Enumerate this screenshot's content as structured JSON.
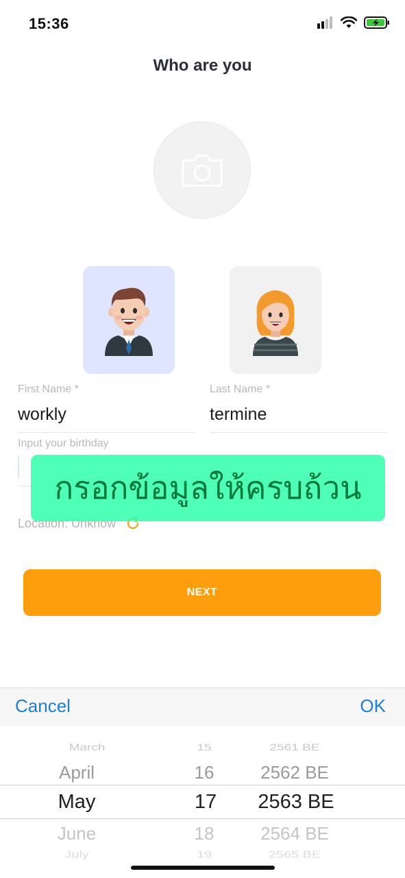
{
  "status": {
    "time": "15:36"
  },
  "header": {
    "title": "Who are you"
  },
  "form": {
    "first_name_label": "First Name *",
    "first_name_value": "workly",
    "last_name_label": "Last Name *",
    "last_name_value": "termine",
    "birthday_label": "Input your birthday",
    "location_text": "Location: Unknow"
  },
  "overlay": {
    "text": "กรอกข้อมูลให้ครบถ้วน"
  },
  "next_button": {
    "label": "NEXT"
  },
  "picker": {
    "cancel_label": "Cancel",
    "ok_label": "OK",
    "months": [
      "March",
      "April",
      "May",
      "June",
      "July"
    ],
    "days": [
      "15",
      "16",
      "17",
      "18",
      "19"
    ],
    "years": [
      "2561 BE",
      "2562 BE",
      "2563 BE",
      "2564 BE",
      "2565 BE"
    ],
    "selected": {
      "month": "May",
      "day": "17",
      "year": "2563 BE"
    }
  },
  "colors": {
    "accent": "#ff9e0c",
    "link": "#1c7fd6",
    "overlay": "#2effaa"
  }
}
